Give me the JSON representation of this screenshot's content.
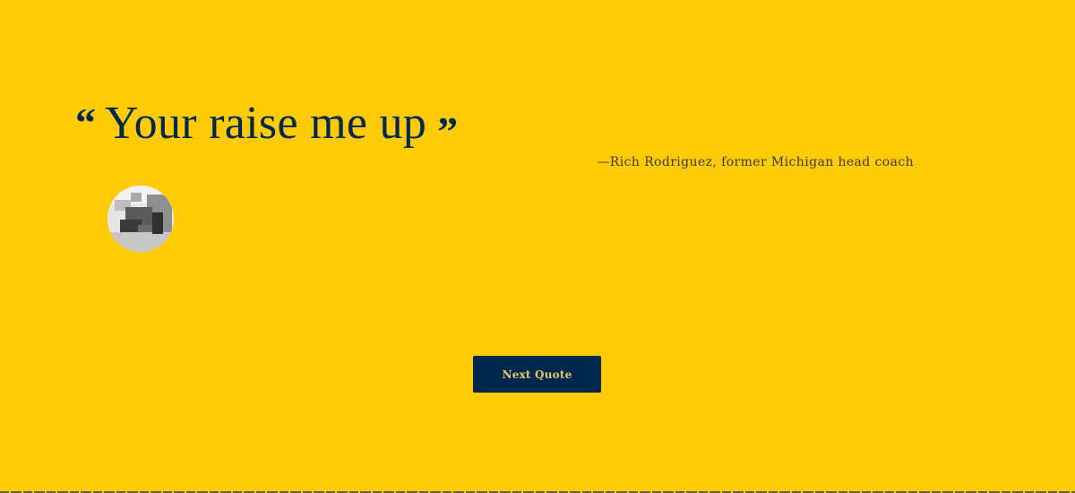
{
  "quote": {
    "open_mark": "“",
    "text": "Your raise me up",
    "close_mark": "”"
  },
  "attribution": "—Rich Rodriguez, former Michigan head coach",
  "avatar": {
    "alt": "Rich Rodriguez"
  },
  "button": {
    "label": "Next Quote"
  },
  "colors": {
    "background": "#FFCB05",
    "navy": "#00274C",
    "button_text": "#E6C76A"
  }
}
